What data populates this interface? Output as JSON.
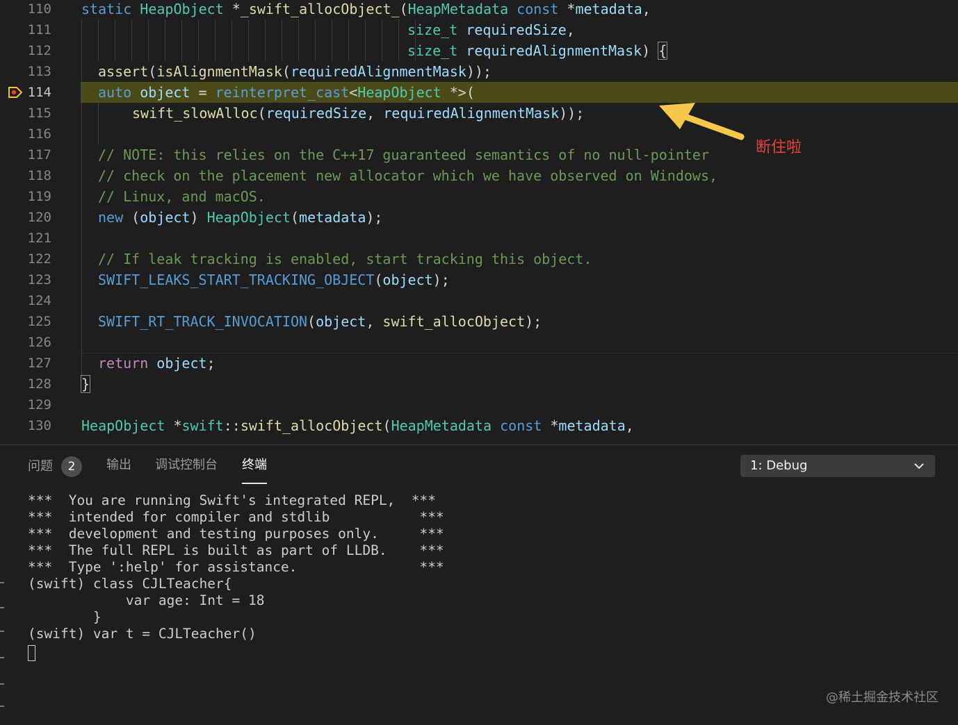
{
  "editor": {
    "lines": [
      {
        "n": "110",
        "segs": [
          [
            "kw",
            "static "
          ],
          [
            "ty",
            "HeapObject "
          ],
          [
            "",
            "*"
          ],
          [
            "fn",
            "_swift_allocObject_"
          ],
          [
            "",
            "("
          ],
          [
            "ty",
            "HeapMetadata "
          ],
          [
            "kw",
            "const "
          ],
          [
            "",
            "*"
          ],
          [
            "var",
            "metadata"
          ],
          [
            "",
            ","
          ]
        ]
      },
      {
        "n": "111",
        "segs": [
          [
            "ty",
            "size_t "
          ],
          [
            "var",
            "requiredSize"
          ],
          [
            "",
            ","
          ]
        ]
      },
      {
        "n": "112",
        "segs": [
          [
            "ty",
            "size_t "
          ],
          [
            "var",
            "requiredAlignmentMask"
          ],
          [
            "",
            ") "
          ],
          [
            "brace",
            "{"
          ]
        ]
      },
      {
        "n": "113",
        "segs": [
          [
            "fn",
            "assert"
          ],
          [
            "",
            "("
          ],
          [
            "fn",
            "isAlignmentMask"
          ],
          [
            "",
            "("
          ],
          [
            "var",
            "requiredAlignmentMask"
          ],
          [
            "",
            "));"
          ]
        ]
      },
      {
        "n": "114",
        "segs": [
          [
            "kw",
            "auto "
          ],
          [
            "var",
            "object"
          ],
          [
            "",
            " = "
          ],
          [
            "kw",
            "reinterpret_cast"
          ],
          [
            "",
            "<"
          ],
          [
            "ty",
            "HeapObject "
          ],
          [
            "",
            "*>("
          ]
        ]
      },
      {
        "n": "115",
        "segs": [
          [
            "fn",
            "swift_slowAlloc"
          ],
          [
            "",
            "("
          ],
          [
            "var",
            "requiredSize"
          ],
          [
            "",
            ", "
          ],
          [
            "var",
            "requiredAlignmentMask"
          ],
          [
            "",
            "));"
          ]
        ]
      },
      {
        "n": "116",
        "segs": []
      },
      {
        "n": "117",
        "segs": [
          [
            "cm",
            "// NOTE: this relies on the C++17 guaranteed semantics of no null-pointer"
          ]
        ]
      },
      {
        "n": "118",
        "segs": [
          [
            "cm",
            "// check on the placement new allocator which we have observed on Windows,"
          ]
        ]
      },
      {
        "n": "119",
        "segs": [
          [
            "cm",
            "// Linux, and macOS."
          ]
        ]
      },
      {
        "n": "120",
        "segs": [
          [
            "kw",
            "new "
          ],
          [
            "",
            "("
          ],
          [
            "var",
            "object"
          ],
          [
            "",
            ") "
          ],
          [
            "ty",
            "HeapObject"
          ],
          [
            "",
            "("
          ],
          [
            "var",
            "metadata"
          ],
          [
            "",
            ");"
          ]
        ]
      },
      {
        "n": "121",
        "segs": []
      },
      {
        "n": "122",
        "segs": [
          [
            "cm",
            "// If leak tracking is enabled, start tracking this object."
          ]
        ]
      },
      {
        "n": "123",
        "segs": [
          [
            "mac",
            "SWIFT_LEAKS_START_TRACKING_OBJECT"
          ],
          [
            "",
            "("
          ],
          [
            "var",
            "object"
          ],
          [
            "",
            ");"
          ]
        ]
      },
      {
        "n": "124",
        "segs": []
      },
      {
        "n": "125",
        "segs": [
          [
            "mac",
            "SWIFT_RT_TRACK_INVOCATION"
          ],
          [
            "",
            "("
          ],
          [
            "var",
            "object"
          ],
          [
            "",
            ", "
          ],
          [
            "fn",
            "swift_allocObject"
          ],
          [
            "",
            ");"
          ]
        ]
      },
      {
        "n": "126",
        "segs": []
      },
      {
        "n": "127",
        "segs": [
          [
            "ctl",
            "return "
          ],
          [
            "var",
            "object"
          ],
          [
            "",
            ";"
          ]
        ]
      },
      {
        "n": "128",
        "segs": [
          [
            "brace",
            "}"
          ]
        ]
      },
      {
        "n": "129",
        "segs": []
      },
      {
        "n": "130",
        "segs": [
          [
            "ty",
            "HeapObject "
          ],
          [
            "",
            "*"
          ],
          [
            "ty",
            "swift"
          ],
          [
            "",
            "::"
          ],
          [
            "fn",
            "swift_allocObject"
          ],
          [
            "",
            "("
          ],
          [
            "ty",
            "HeapMetadata "
          ],
          [
            "kw",
            "const "
          ],
          [
            "",
            "*"
          ],
          [
            "var",
            "metadata"
          ],
          [
            "",
            ","
          ]
        ]
      }
    ],
    "annotation": "断住啦"
  },
  "panel": {
    "tabs": [
      {
        "label": "问题",
        "badge": "2"
      },
      {
        "label": "输出"
      },
      {
        "label": "调试控制台"
      },
      {
        "label": "终端"
      }
    ],
    "terminal_select": "1: Debug",
    "terminal_text": "***  You are running Swift's integrated REPL,  ***\n***  intended for compiler and stdlib           ***\n***  development and testing purposes only.     ***\n***  The full REPL is built as part of LLDB.    ***\n***  Type ':help' for assistance.               ***\n(swift) class CJLTeacher{\n            var age: Int = 18\n        }\n(swift) var t = CJLTeacher()"
  },
  "watermark": "@稀土掘金技术社区",
  "colors": {
    "background": "#1e1e1e",
    "current_line": "#4b4b18",
    "keyword": "#569cd6",
    "type": "#4ec9b0",
    "function": "#dcdcaa",
    "variable": "#9cdcfe",
    "comment": "#6a9955",
    "annotation": "#e8413a",
    "arrow": "#f5c84a"
  },
  "icons": {
    "breakpoint": "breakpoint-paused-icon",
    "arrow": "annotation-arrow-icon",
    "dropdown": "chevron-down-icon"
  }
}
